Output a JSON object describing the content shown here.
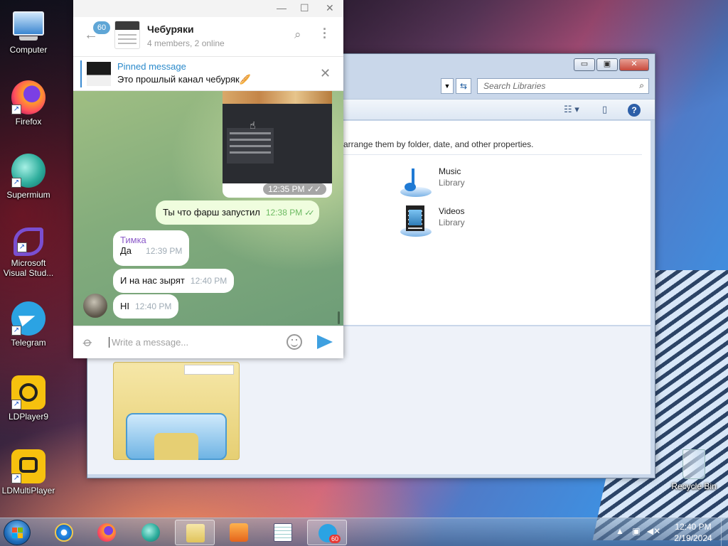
{
  "desktop": {
    "icons": [
      {
        "label": "Computer"
      },
      {
        "label": "Firefox"
      },
      {
        "label": "Supermium"
      },
      {
        "label": "Microsoft Visual Stud..."
      },
      {
        "label": "Telegram"
      },
      {
        "label": "LDPlayer9"
      },
      {
        "label": "LDMultiPlayer"
      },
      {
        "label": "Recycle Bin"
      }
    ]
  },
  "explorer": {
    "search_placeholder": "Search Libraries",
    "description": "d arrange them by folder, date, and other properties.",
    "libraries": [
      {
        "name": "Music",
        "type": "Library"
      },
      {
        "name": "Videos",
        "type": "Library"
      }
    ],
    "title_buttons": {
      "minimize": "▭",
      "maximize": "▣",
      "close": "✕"
    }
  },
  "telegram": {
    "window_buttons": {
      "minimize": "—",
      "maximize": "☐",
      "close": "✕"
    },
    "unread_count": "60",
    "chat_name": "Чебуряки",
    "chat_status": "4 members, 2 online",
    "pinned": {
      "title": "Pinned message",
      "text": "Это прошлый канал чебуряк🥖"
    },
    "image_message": {
      "time": "12:35 PM",
      "ticks": "✓✓"
    },
    "messages": [
      {
        "direction": "out",
        "text": "Ты что фарш запустил",
        "time": "12:38 PM",
        "ticks": "✓✓"
      },
      {
        "direction": "in",
        "sender": "Тимка",
        "text": "Да",
        "time": "12:39 PM"
      },
      {
        "direction": "in",
        "text": "И на нас зырят",
        "time": "12:40 PM"
      },
      {
        "direction": "in",
        "text": "НІ",
        "time": "12:40 PM"
      }
    ],
    "compose_placeholder": "Write a message..."
  },
  "taskbar": {
    "apps": [
      "internet-explorer",
      "firefox",
      "supermium",
      "windows-explorer",
      "media-player",
      "notepad",
      "telegram"
    ],
    "telegram_badge": "60",
    "clock": {
      "time": "12:40 PM",
      "date": "2/19/2024"
    }
  },
  "colors": {
    "telegram_accent": "#2b8acb",
    "outgoing_bubble": "#effdde",
    "sender_name": "#8c5bc9",
    "taskbar_badge": "#e53935"
  }
}
